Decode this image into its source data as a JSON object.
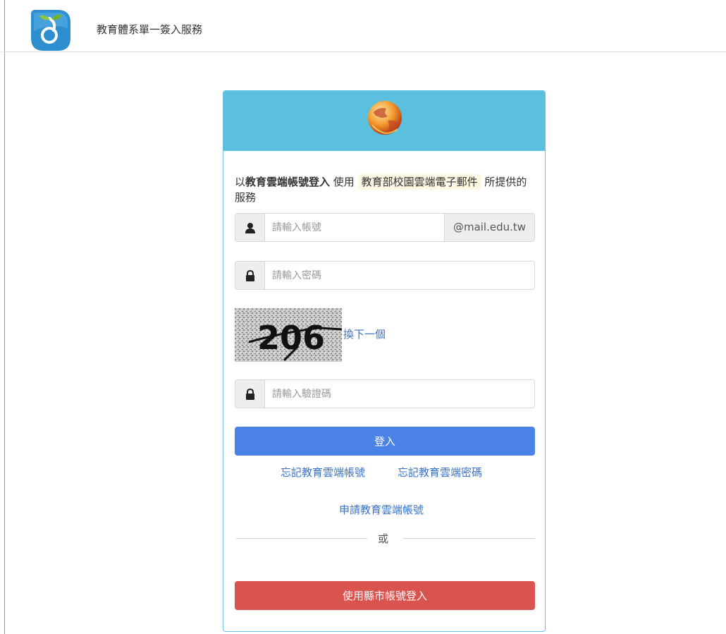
{
  "header": {
    "title": "教育體系單一簽入服務"
  },
  "login": {
    "intro_prefix": "以",
    "intro_bold": "教育雲端帳號登入",
    "intro_mid": " 使用 ",
    "intro_service": "教育部校園雲端電子郵件",
    "intro_suffix": " 所提供的服務",
    "account_placeholder": "請輸入帳號",
    "account_suffix": "@mail.edu.tw",
    "password_placeholder": "請輸入密碼",
    "captcha_code": "206",
    "captcha_refresh": "換下一個",
    "captcha_placeholder": "請輸入驗證碼",
    "login_button": "登入",
    "forgot_account": "忘記教育雲端帳號",
    "forgot_password": "忘記教育雲端密碼",
    "apply_account": "申請教育雲端帳號",
    "or_text": "或",
    "county_login_button": "使用縣市帳號登入"
  },
  "colors": {
    "header_bar": "#5bc0de",
    "login_button": "#4a82e8",
    "county_button": "#d9534f",
    "link": "#3a73c9"
  },
  "icons": [
    "sprout-logo-icon",
    "globe-icon",
    "user-icon",
    "lock-icon"
  ]
}
